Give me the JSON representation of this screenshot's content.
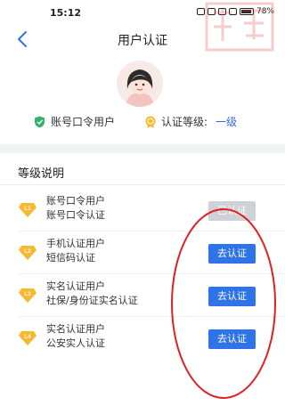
{
  "status_bar": {
    "time": "15:12",
    "right_text": "78%"
  },
  "watermark": {
    "kind": "seal-stamp",
    "color": "#d9534f"
  },
  "nav": {
    "title": "用户认证",
    "back_icon": "chevron-left-icon"
  },
  "user": {
    "avatar": "user-avatar-icon",
    "account_label": "账号口令用户",
    "level_label": "认证等级:",
    "level_value": "一级"
  },
  "section": {
    "title": "等级说明"
  },
  "levels": [
    {
      "badge": "L1",
      "line1": "账号口令用户",
      "line2": "账号口令认证",
      "button": "已认证",
      "state": "done"
    },
    {
      "badge": "L2",
      "line1": "手机认证用户",
      "line2": "短信码认证",
      "button": "去认证",
      "state": "pending"
    },
    {
      "badge": "L3",
      "line1": "实名认证用户",
      "line2": "社保/身份证实名认证",
      "button": "去认证",
      "state": "pending"
    },
    {
      "badge": "L4",
      "line1": "实名认证用户",
      "line2": "公安实人认证",
      "button": "去认证",
      "state": "pending"
    }
  ],
  "colors": {
    "accent": "#2f73e8",
    "done_button": "#cfd1d6",
    "badge_gold": "#f5b82e",
    "shield_green": "#34b36b",
    "annotation_red": "#e02020"
  }
}
